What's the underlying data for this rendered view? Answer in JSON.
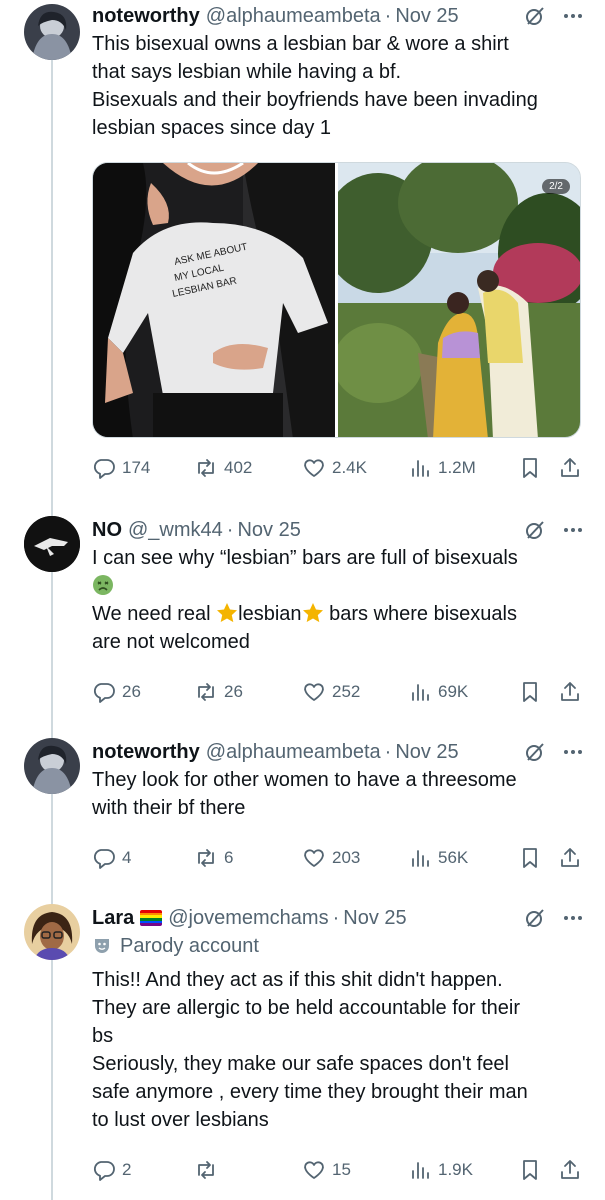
{
  "colors": {
    "text": "#0f1419",
    "muted": "#536471",
    "border": "#cfd9de",
    "star": "#f4b400",
    "nausea": "#6aa84f"
  },
  "posts": [
    {
      "name": "noteworthy",
      "handle": "@alphaumeambeta",
      "dot": "·",
      "date": "Nov 25",
      "lines": [
        "This bisexual owns a lesbian bar & wore a shirt",
        "that says lesbian while having a bf.",
        "Bisexuals and their boyfriends have been invading",
        "lesbian spaces since day 1"
      ],
      "media": {
        "shirt_text": [
          "ASK ME ABOUT",
          "MY LOCAL",
          "LESBIAN BAR"
        ],
        "badge": "2/2"
      },
      "actions": {
        "replies": "174",
        "reposts": "402",
        "likes": "2.4K",
        "views": "1.2M"
      }
    },
    {
      "name": "NO",
      "handle": "@_wmk44",
      "dot": "·",
      "date": "Nov 25",
      "line1": "I can see why “lesbian” bars are full of bisexuals",
      "line3a": "We need real ",
      "line3b": "lesbian",
      "line3c": " bars where bisexuals",
      "line4": "are not welcomed",
      "emoji_1": "nauseated-face",
      "emoji_2": "star",
      "actions": {
        "replies": "26",
        "reposts": "26",
        "likes": "252",
        "views": "69K"
      }
    },
    {
      "name": "noteworthy",
      "handle": "@alphaumeambeta",
      "dot": "·",
      "date": "Nov 25",
      "lines": [
        "They look for other women to have a threesome",
        "with their bf there"
      ],
      "actions": {
        "replies": "4",
        "reposts": "6",
        "likes": "203",
        "views": "56K"
      }
    },
    {
      "name": "Lara",
      "handle": "@jovememchams",
      "dot": "·",
      "date": "Nov 25",
      "flag": "rainbow-flag",
      "parody_label": "Parody account",
      "lines": [
        "This!! And they act as if this shit didn't happen.",
        "They are allergic to be held accountable for their",
        "bs",
        "Seriously, they make our safe spaces don't feel",
        "safe anymore , every time they brought their man",
        "to lust over lesbians"
      ],
      "actions": {
        "replies": "2",
        "reposts": "",
        "likes": "15",
        "views": "1.9K"
      }
    }
  ],
  "icons": {
    "reply": "reply-icon",
    "repost": "repost-icon",
    "like": "heart-icon",
    "views": "views-icon",
    "bookmark": "bookmark-icon",
    "share": "share-icon",
    "grok": "grok-icon",
    "more": "more-icon",
    "parody": "parody-mask-icon"
  }
}
